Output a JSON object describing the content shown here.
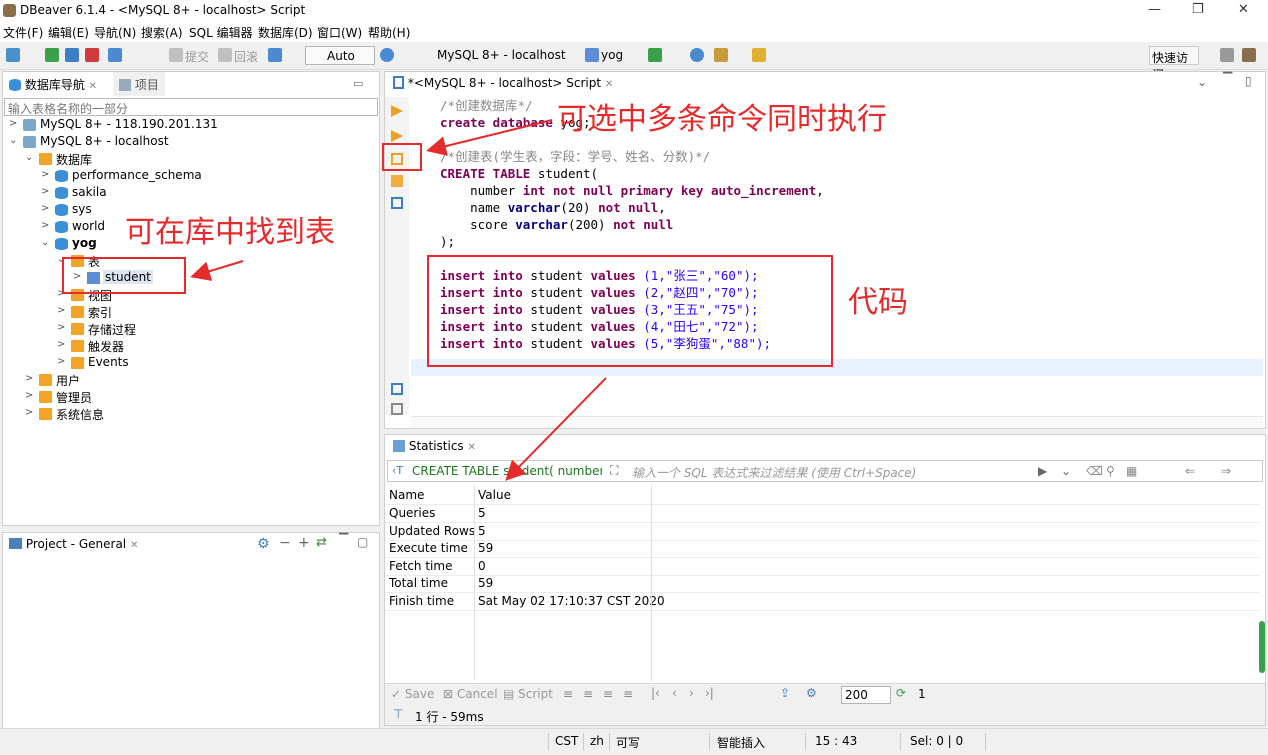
{
  "window": {
    "title": "DBeaver 6.1.4 - <MySQL 8+ - localhost> Script",
    "minimize_glyph": "—",
    "maximize_glyph": "❐",
    "close_glyph": "✕"
  },
  "menu": [
    "文件(F)",
    "编辑(E)",
    "导航(N)",
    "搜索(A)",
    "SQL 编辑器",
    "数据库(D)",
    "窗口(W)",
    "帮助(H)"
  ],
  "toolbar": {
    "commit_label": "提交",
    "rollback_label": "回滚",
    "mode_label": "Auto",
    "connection_label": "MySQL 8+ - localhost",
    "schema_label": "yog",
    "quick_access_label": "快速访问"
  },
  "navigator": {
    "tab_label": "数据库导航",
    "tab2_label": "项目",
    "filter_placeholder": "输入表格名称的一部分",
    "tree": {
      "conn1": "MySQL 8+ - 118.190.201.131",
      "conn2": "MySQL 8+ - localhost",
      "databases": "数据库",
      "db1": "performance_schema",
      "db2": "sakila",
      "db3": "sys",
      "db4": "world",
      "db5": "yog",
      "tables": "表",
      "table1": "student",
      "views": "视图",
      "indexes": "索引",
      "procedures": "存储过程",
      "triggers": "触发器",
      "events": "Events",
      "users": "用户",
      "admins": "管理员",
      "sysinfo": "系统信息"
    }
  },
  "project_panel": {
    "tab_label": "Project - General"
  },
  "editor": {
    "tab_label": "*<MySQL 8+ - localhost> Script",
    "lines": {
      "l1": "/*创建数据库*/",
      "l2a": "create database ",
      "l2b": "yog;",
      "l4": "/*创建表(学生表，字段：学号、姓名、分数)*/",
      "l5a": "CREATE TABLE",
      "l5b": " student(",
      "l6a": "    number ",
      "l6b": "int not null primary key auto_increment",
      "l6c": ",",
      "l7a": "    name ",
      "l7b": "varchar",
      "l7c": "(20) ",
      "l7d": "not null",
      "l7e": ",",
      "l8a": "    score ",
      "l8b": "varchar",
      "l8c": "(200) ",
      "l8d": "not null",
      "l9": ");",
      "i1": "(1,\"张三\",\"60\");",
      "i2": "(2,\"赵四\",\"70\");",
      "i3": "(3,\"王五\",\"75\");",
      "i4": "(4,\"田七\",\"72\");",
      "i5": "(5,\"李狗蛋\",\"88\");",
      "insert_kw": "insert into",
      "student": " student ",
      "values_kw": "values "
    }
  },
  "results": {
    "tab_label": "Statistics",
    "sql_preview": "CREATE TABLE student( number i",
    "filter_placeholder": "输入一个 SQL 表达式来过滤结果 (使用 Ctrl+Space)",
    "columns": [
      "Name",
      "Value"
    ],
    "rows": [
      [
        "Queries",
        "5"
      ],
      [
        "Updated Rows",
        "5"
      ],
      [
        "Execute time",
        "59"
      ],
      [
        "Fetch time",
        "0"
      ],
      [
        "Total time",
        "59"
      ],
      [
        "Finish time",
        "Sat May 02 17:10:37 CST 2020"
      ]
    ],
    "bottom": {
      "save": "Save",
      "cancel": "Cancel",
      "script": "Script",
      "fetch_size": "200",
      "refresh_count": "1"
    },
    "status": "1 行 - 59ms"
  },
  "statusbar": {
    "tz": "CST",
    "lang": "zh",
    "writable": "可写",
    "insert_mode": "智能插入",
    "position": "15 : 43",
    "selection": "Sel: 0 | 0"
  },
  "annotations": {
    "a1": "可选中多条命令同时执行",
    "a2": "可在库中找到表",
    "a3": "代码"
  },
  "colors": {
    "annotation": "#e52b2b",
    "keyword": "#7f0055",
    "string": "#2a00ff"
  }
}
